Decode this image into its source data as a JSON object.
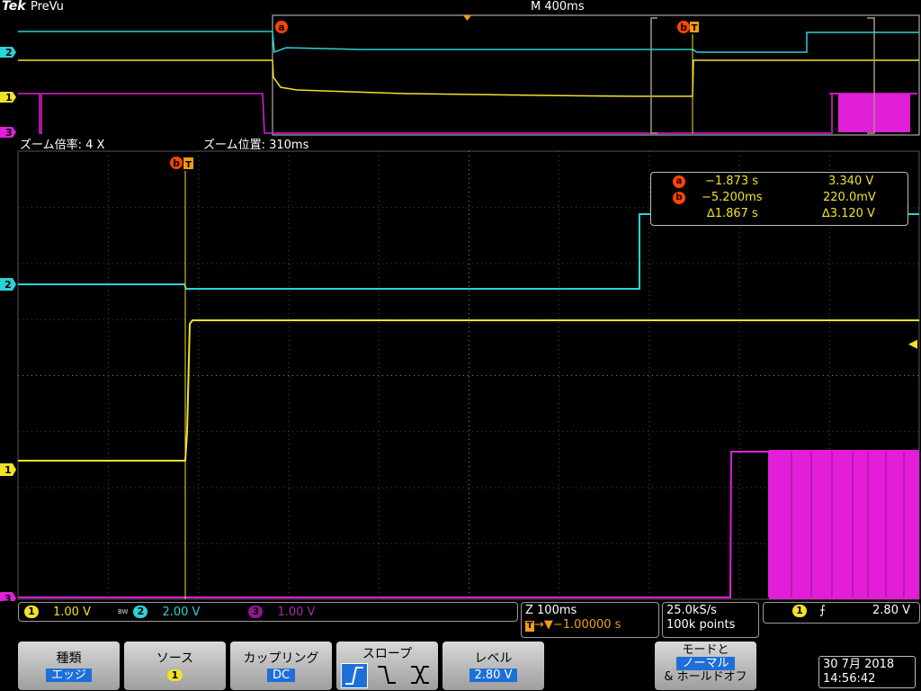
{
  "header": {
    "brand": "Tek",
    "mode": "PreVu",
    "timebase": "M 400ms"
  },
  "zoom": {
    "factor_label": "ズーム倍率: 4 X",
    "position_label": "ズーム位置: 310ms"
  },
  "markers": {
    "cursor_a": "a",
    "cursor_b": "b",
    "trigger": "T"
  },
  "channel_markers": {
    "ch1": "1",
    "ch2": "2",
    "ch3": "3"
  },
  "cursor_readout": {
    "a_time": "−1.873 s",
    "a_volt": "3.340 V",
    "b_time": "−5.200ms",
    "b_volt": "220.0mV",
    "delta_time": "∆1.867 s",
    "delta_volt": "∆3.120 V"
  },
  "channels": {
    "ch1_scale": "1.00 V",
    "bw_label": "BW",
    "ch2_scale": "2.00 V",
    "ch3_scale": "1.00 V"
  },
  "horizontal": {
    "zoom_scale": "Z 100ms",
    "trigger_pos": "→▼−1.00000 s",
    "sample_rate": "25.0kS/s",
    "record_length": "100k points"
  },
  "trigger_info": {
    "source": "1",
    "slope_symbol": "⨍",
    "level": "2.80 V"
  },
  "datetime": {
    "date": "30 7月  2018",
    "time": "14:56:42"
  },
  "softkeys": {
    "type": {
      "label": "種類",
      "value": "エッジ"
    },
    "source": {
      "label": "ソース",
      "value": "1"
    },
    "coupling": {
      "label": "カップリング",
      "value": "DC"
    },
    "slope": {
      "label": "スロープ"
    },
    "level": {
      "label": "レベル",
      "value": "2.80 V"
    },
    "mode": {
      "label_line1": "モードと",
      "value": "ノーマル",
      "label_line3": "& ホールドオフ"
    }
  },
  "colors": {
    "ch1": "#f2e12b",
    "ch2": "#29d3d8",
    "ch3": "#e21ed8",
    "cursor": "#ff4500",
    "accent": "#1e6fd8"
  }
}
